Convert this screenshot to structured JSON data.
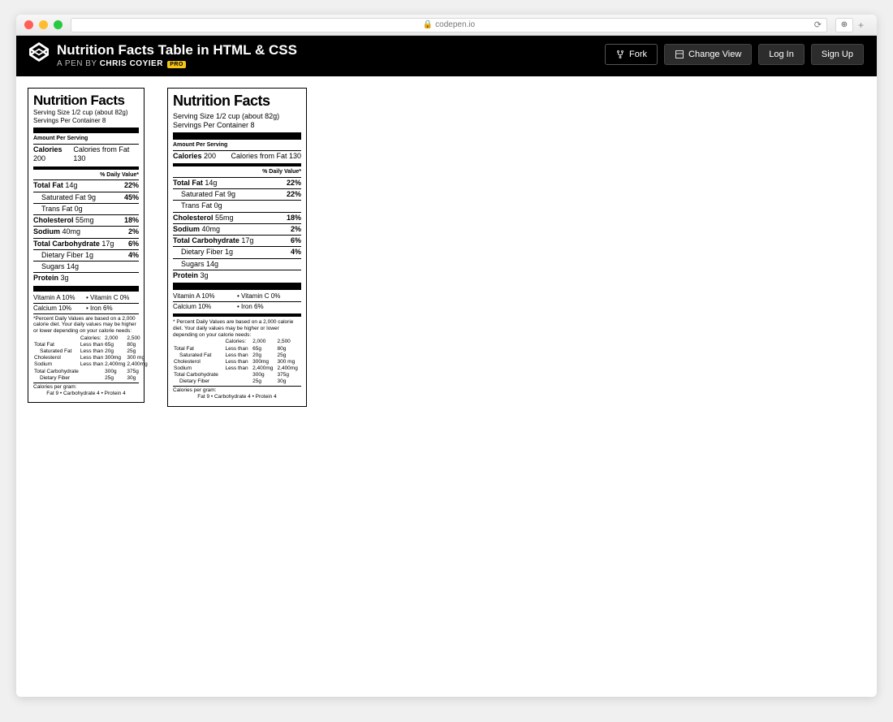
{
  "browser": {
    "url": "codepen.io",
    "lock": "🔒",
    "reload": "⟳",
    "expand": "⊕",
    "plus": "+"
  },
  "header": {
    "title": "Nutrition Facts Table in HTML & CSS",
    "byline_prefix": "A PEN BY ",
    "author": "Chris Coyier",
    "pro": "PRO",
    "fork": "Fork",
    "change_view": "Change View",
    "login": "Log In",
    "signup": "Sign Up"
  },
  "label": {
    "title": "Nutrition Facts",
    "serving_size": "Serving Size 1/2 cup (about 82g)",
    "servings_per": "Servings Per Container 8",
    "aps": "Amount Per Serving",
    "calories_lbl": "Calories",
    "calories_val": "200",
    "calories_fat_lbl": "Calories from Fat",
    "calories_fat_val": "130",
    "dv_hdr": "% Daily Value*",
    "rows": [
      {
        "name": "Total Fat",
        "amt": "14g",
        "dv": "22%",
        "bold": true
      },
      {
        "name": "Saturated Fat",
        "amt": "9g",
        "dv": "22%",
        "indent": 1,
        "large_dv": "22%",
        "small_dv": "45%"
      },
      {
        "name": "Trans Fat",
        "amt": "0g",
        "dv": "",
        "indent": 1
      },
      {
        "name": "Cholesterol",
        "amt": "55mg",
        "dv": "18%",
        "bold": true
      },
      {
        "name": "Sodium",
        "amt": "40mg",
        "dv": "2%",
        "bold": true
      },
      {
        "name": "Total Carbohydrate",
        "amt": "17g",
        "dv": "6%",
        "bold": true
      },
      {
        "name": "Dietary Fiber",
        "amt": "1g",
        "dv": "4%",
        "indent": 1
      },
      {
        "name": "Sugars",
        "amt": "14g",
        "dv": "",
        "indent": 1
      },
      {
        "name": "Protein",
        "amt": "3g",
        "dv": "",
        "bold": true
      }
    ],
    "vitamins": {
      "a": "Vitamin A 10%",
      "c": "Vitamin C 0%",
      "cal": "Calcium 10%",
      "iron": "Iron 6%"
    },
    "footnote": "* Percent Daily Values are based on a 2,000 calorie diet. Your daily values may be higher or lower depending on your calorie needs:",
    "footnote_small": "*Percent Daily Values are based on a 2,000 calorie diet. Your daily values may be higher or lower depending on your calorie needs:",
    "ref_hdr": {
      "c1": "",
      "c2": "Calories:",
      "c3": "2,000",
      "c4": "2,500"
    },
    "ref": [
      {
        "c1": "Total Fat",
        "c2": "Less than",
        "c3": "65g",
        "c4": "80g"
      },
      {
        "c1": "Saturated Fat",
        "c2": "Less than",
        "c3": "20g",
        "c4": "25g",
        "indent": 1
      },
      {
        "c1": "Cholesterol",
        "c2": "Less than",
        "c3": "300mg",
        "c4": "300 mg"
      },
      {
        "c1": "Sodium",
        "c2": "Less than",
        "c3": "2,400mg",
        "c4": "2,400mg"
      },
      {
        "c1": "Total Carbohydrate",
        "c2": "",
        "c3": "300g",
        "c4": "375g"
      },
      {
        "c1": "Dietary Fiber",
        "c2": "",
        "c3": "25g",
        "c4": "30g",
        "indent": 1
      }
    ],
    "cpg_lbl": "Calories per gram:",
    "cpg_line": "Fat 9  •  Carbohydrate 4  •  Protein 4"
  }
}
